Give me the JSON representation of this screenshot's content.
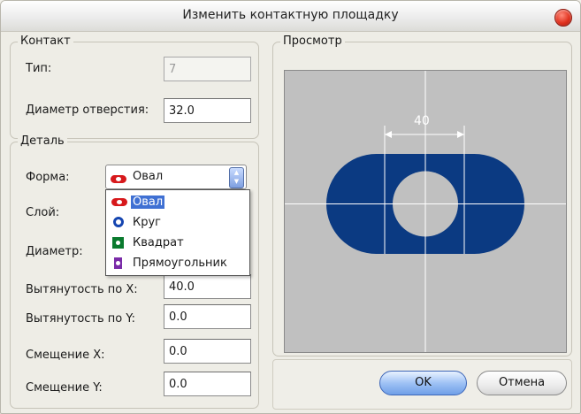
{
  "window": {
    "title": "Изменить контактную площадку",
    "close_icon": "close-icon"
  },
  "contact": {
    "group_label": "Контакт",
    "type_label": "Тип:",
    "type_value": "7",
    "hole_label": "Диаметр отверстия:",
    "hole_value": "32.0"
  },
  "detail": {
    "group_label": "Деталь",
    "shape_label": "Форма:",
    "shape_value": "Овал",
    "layer_label": "Слой:",
    "diameter_label": "Диаметр:",
    "stretch_x_label": "Вытянутость по X:",
    "stretch_x_value": "40.0",
    "stretch_y_label": "Вытянутость по Y:",
    "stretch_y_value": "0.0",
    "offset_x_label": "Смещение X:",
    "offset_x_value": "0.0",
    "offset_y_label": "Смещение Y:",
    "offset_y_value": "0.0"
  },
  "shape_options": [
    {
      "label": "Овал",
      "icon": "oval-icon",
      "selected": true
    },
    {
      "label": "Круг",
      "icon": "circle-icon",
      "selected": false
    },
    {
      "label": "Квадрат",
      "icon": "square-icon",
      "selected": false
    },
    {
      "label": "Прямоугольник",
      "icon": "rectangle-icon",
      "selected": false
    }
  ],
  "preview": {
    "group_label": "Просмотр",
    "dimension_label": "40",
    "pad_color": "#0b3a82",
    "background_color": "#c0c0c0"
  },
  "buttons": {
    "ok": "OK",
    "cancel": "Отмена"
  }
}
